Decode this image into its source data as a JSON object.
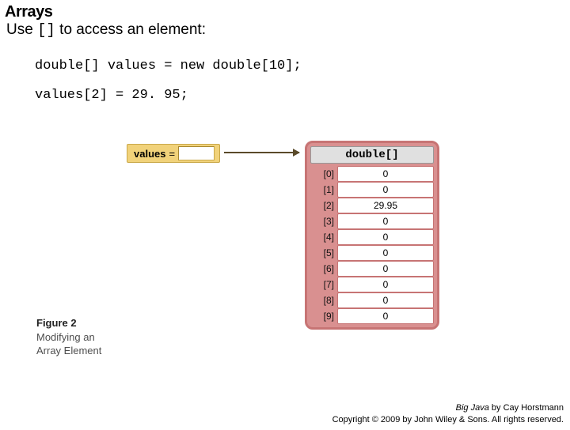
{
  "title": "Arrays",
  "subtitle_pre": "Use ",
  "subtitle_brackets": "[]",
  "subtitle_post": " to access an element:",
  "code": {
    "line1": "double[] values = new double[10];",
    "line2": "values[2] = 29. 95;"
  },
  "diagram": {
    "var_name": "values",
    "var_eq": "=",
    "array_type": "double[]",
    "rows": [
      {
        "idx": "[0]",
        "val": "0"
      },
      {
        "idx": "[1]",
        "val": "0"
      },
      {
        "idx": "[2]",
        "val": "29.95"
      },
      {
        "idx": "[3]",
        "val": "0"
      },
      {
        "idx": "[4]",
        "val": "0"
      },
      {
        "idx": "[5]",
        "val": "0"
      },
      {
        "idx": "[6]",
        "val": "0"
      },
      {
        "idx": "[7]",
        "val": "0"
      },
      {
        "idx": "[8]",
        "val": "0"
      },
      {
        "idx": "[9]",
        "val": "0"
      }
    ]
  },
  "figure": {
    "num": "Figure 2",
    "line1": "Modifying an",
    "line2": "Array Element"
  },
  "footer": {
    "line1a": "Big Java",
    "line1b": " by Cay Horstmann",
    "line2": "Copyright © 2009 by John Wiley & Sons. All rights reserved."
  }
}
